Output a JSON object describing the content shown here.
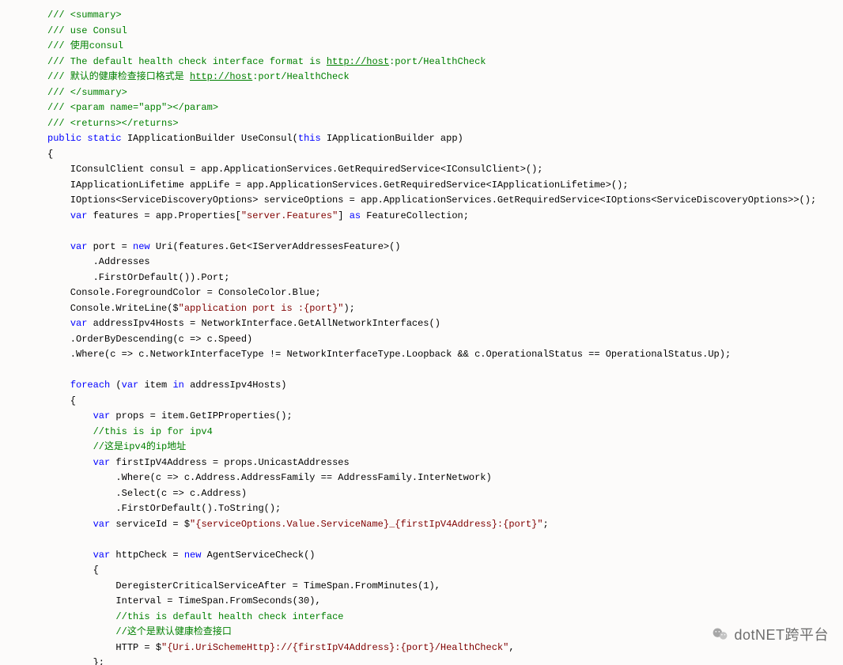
{
  "watermark": {
    "text": "dotNET跨平台"
  },
  "code": {
    "lines": [
      [
        {
          "t": "comment",
          "v": "/// <summary>"
        }
      ],
      [
        {
          "t": "comment",
          "v": "/// use Consul"
        }
      ],
      [
        {
          "t": "comment",
          "v": "/// 使用consul"
        }
      ],
      [
        {
          "t": "comment",
          "v": "/// The default health check interface format is "
        },
        {
          "t": "link",
          "v": "http://host"
        },
        {
          "t": "comment",
          "v": ":port/HealthCheck"
        }
      ],
      [
        {
          "t": "comment",
          "v": "/// 默认的健康检查接口格式是 "
        },
        {
          "t": "link",
          "v": "http://host"
        },
        {
          "t": "comment",
          "v": ":port/HealthCheck"
        }
      ],
      [
        {
          "t": "comment",
          "v": "/// </summary>"
        }
      ],
      [
        {
          "t": "comment",
          "v": "/// <param name=\"app\"></param>"
        }
      ],
      [
        {
          "t": "comment",
          "v": "/// <returns></returns>"
        }
      ],
      [
        {
          "t": "keyword",
          "v": "public"
        },
        {
          "t": "plain",
          "v": " "
        },
        {
          "t": "keyword",
          "v": "static"
        },
        {
          "t": "plain",
          "v": " IApplicationBuilder UseConsul("
        },
        {
          "t": "keyword",
          "v": "this"
        },
        {
          "t": "plain",
          "v": " IApplicationBuilder app)"
        }
      ],
      [
        {
          "t": "plain",
          "v": "{"
        }
      ],
      [
        {
          "t": "plain",
          "v": "    IConsulClient consul = app.ApplicationServices.GetRequiredService<IConsulClient>();"
        }
      ],
      [
        {
          "t": "plain",
          "v": "    IApplicationLifetime appLife = app.ApplicationServices.GetRequiredService<IApplicationLifetime>();"
        }
      ],
      [
        {
          "t": "plain",
          "v": "    IOptions<ServiceDiscoveryOptions> serviceOptions = app.ApplicationServices.GetRequiredService<IOptions<ServiceDiscoveryOptions>>();"
        }
      ],
      [
        {
          "t": "plain",
          "v": "    "
        },
        {
          "t": "keyword",
          "v": "var"
        },
        {
          "t": "plain",
          "v": " features = app.Properties["
        },
        {
          "t": "string",
          "v": "\"server.Features\""
        },
        {
          "t": "plain",
          "v": "] "
        },
        {
          "t": "keyword",
          "v": "as"
        },
        {
          "t": "plain",
          "v": " FeatureCollection;"
        }
      ],
      [
        {
          "t": "plain",
          "v": ""
        }
      ],
      [
        {
          "t": "plain",
          "v": "    "
        },
        {
          "t": "keyword",
          "v": "var"
        },
        {
          "t": "plain",
          "v": " port = "
        },
        {
          "t": "keyword",
          "v": "new"
        },
        {
          "t": "plain",
          "v": " Uri(features.Get<IServerAddressesFeature>()"
        }
      ],
      [
        {
          "t": "plain",
          "v": "        .Addresses"
        }
      ],
      [
        {
          "t": "plain",
          "v": "        .FirstOrDefault()).Port;"
        }
      ],
      [
        {
          "t": "plain",
          "v": "    Console.ForegroundColor = ConsoleColor.Blue;"
        }
      ],
      [
        {
          "t": "plain",
          "v": "    Console.WriteLine($"
        },
        {
          "t": "string",
          "v": "\"application port is :{port}\""
        },
        {
          "t": "plain",
          "v": ");"
        }
      ],
      [
        {
          "t": "plain",
          "v": "    "
        },
        {
          "t": "keyword",
          "v": "var"
        },
        {
          "t": "plain",
          "v": " addressIpv4Hosts = NetworkInterface.GetAllNetworkInterfaces()"
        }
      ],
      [
        {
          "t": "plain",
          "v": "    .OrderByDescending(c => c.Speed)"
        }
      ],
      [
        {
          "t": "plain",
          "v": "    .Where(c => c.NetworkInterfaceType != NetworkInterfaceType.Loopback && c.OperationalStatus == OperationalStatus.Up);"
        }
      ],
      [
        {
          "t": "plain",
          "v": ""
        }
      ],
      [
        {
          "t": "plain",
          "v": "    "
        },
        {
          "t": "keyword",
          "v": "foreach"
        },
        {
          "t": "plain",
          "v": " ("
        },
        {
          "t": "keyword",
          "v": "var"
        },
        {
          "t": "plain",
          "v": " item "
        },
        {
          "t": "keyword",
          "v": "in"
        },
        {
          "t": "plain",
          "v": " addressIpv4Hosts)"
        }
      ],
      [
        {
          "t": "plain",
          "v": "    {"
        }
      ],
      [
        {
          "t": "plain",
          "v": "        "
        },
        {
          "t": "keyword",
          "v": "var"
        },
        {
          "t": "plain",
          "v": " props = item.GetIPProperties();"
        }
      ],
      [
        {
          "t": "plain",
          "v": "        "
        },
        {
          "t": "comment",
          "v": "//this is ip for ipv4"
        }
      ],
      [
        {
          "t": "plain",
          "v": "        "
        },
        {
          "t": "comment",
          "v": "//这是ipv4的ip地址"
        }
      ],
      [
        {
          "t": "plain",
          "v": "        "
        },
        {
          "t": "keyword",
          "v": "var"
        },
        {
          "t": "plain",
          "v": " firstIpV4Address = props.UnicastAddresses"
        }
      ],
      [
        {
          "t": "plain",
          "v": "            .Where(c => c.Address.AddressFamily == AddressFamily.InterNetwork)"
        }
      ],
      [
        {
          "t": "plain",
          "v": "            .Select(c => c.Address)"
        }
      ],
      [
        {
          "t": "plain",
          "v": "            .FirstOrDefault().ToString();"
        }
      ],
      [
        {
          "t": "plain",
          "v": "        "
        },
        {
          "t": "keyword",
          "v": "var"
        },
        {
          "t": "plain",
          "v": " serviceId = $"
        },
        {
          "t": "string",
          "v": "\"{serviceOptions.Value.ServiceName}_{firstIpV4Address}:{port}\""
        },
        {
          "t": "plain",
          "v": ";"
        }
      ],
      [
        {
          "t": "plain",
          "v": ""
        }
      ],
      [
        {
          "t": "plain",
          "v": "        "
        },
        {
          "t": "keyword",
          "v": "var"
        },
        {
          "t": "plain",
          "v": " httpCheck = "
        },
        {
          "t": "keyword",
          "v": "new"
        },
        {
          "t": "plain",
          "v": " AgentServiceCheck()"
        }
      ],
      [
        {
          "t": "plain",
          "v": "        {"
        }
      ],
      [
        {
          "t": "plain",
          "v": "            DeregisterCriticalServiceAfter = TimeSpan.FromMinutes(1),"
        }
      ],
      [
        {
          "t": "plain",
          "v": "            Interval = TimeSpan.FromSeconds(30),"
        }
      ],
      [
        {
          "t": "plain",
          "v": "            "
        },
        {
          "t": "comment",
          "v": "//this is default health check interface"
        }
      ],
      [
        {
          "t": "plain",
          "v": "            "
        },
        {
          "t": "comment",
          "v": "//这个是默认健康检查接口"
        }
      ],
      [
        {
          "t": "plain",
          "v": "            HTTP = $"
        },
        {
          "t": "string",
          "v": "\"{Uri.UriSchemeHttp}://{firstIpV4Address}:{port}/HealthCheck\""
        },
        {
          "t": "plain",
          "v": ","
        }
      ],
      [
        {
          "t": "plain",
          "v": "        };"
        }
      ]
    ]
  }
}
